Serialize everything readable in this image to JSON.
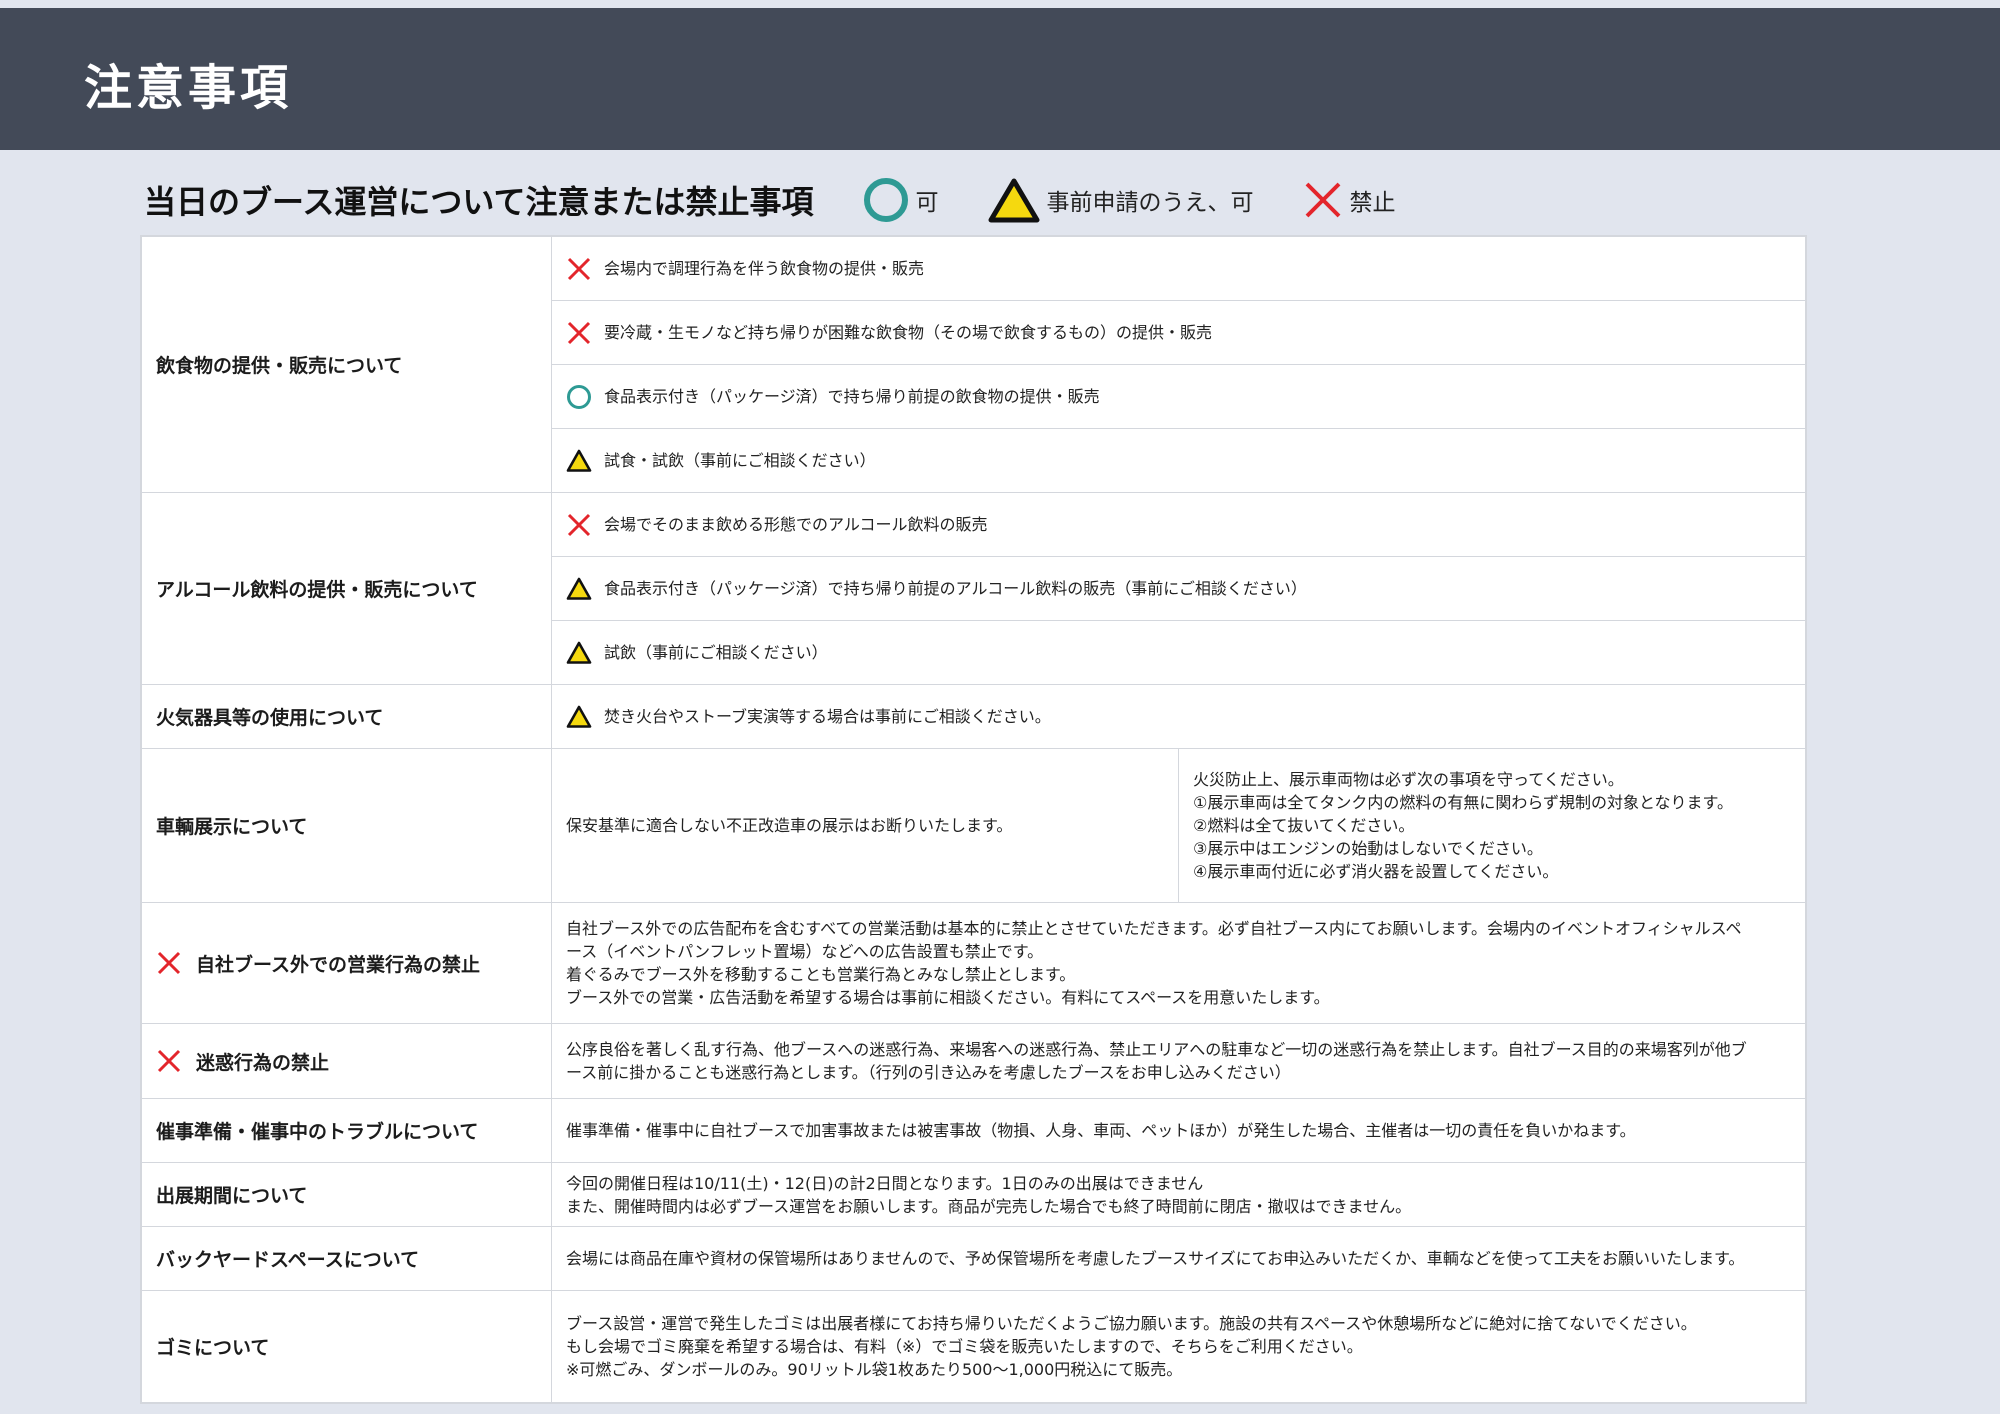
{
  "header": {
    "title": "注意事項"
  },
  "subtitle": "当日のブース運営について注意または禁止事項",
  "legend": [
    {
      "symbol": "circle",
      "label": "可"
    },
    {
      "symbol": "triangle",
      "label": "事前申請のうえ、可"
    },
    {
      "symbol": "cross",
      "label": "禁止"
    }
  ],
  "colors": {
    "header_bg": "#434a58",
    "page_bg": "#e1e5ee",
    "cross": "#e3252b",
    "circle": "#2e9a94",
    "triangle_fill": "#f5d90f"
  },
  "sections": {
    "food": {
      "label": "飲食物の提供・販売について",
      "items": [
        {
          "symbol": "cross",
          "text": "会場内で調理行為を伴う飲食物の提供・販売"
        },
        {
          "symbol": "cross",
          "text": "要冷蔵・生モノなど持ち帰りが困難な飲食物（その場で飲食するもの）の提供・販売"
        },
        {
          "symbol": "circle",
          "text": "食品表示付き（パッケージ済）で持ち帰り前提の飲食物の提供・販売"
        },
        {
          "symbol": "triangle",
          "text": "試食・試飲（事前にご相談ください）"
        }
      ]
    },
    "alcohol": {
      "label": "アルコール飲料の提供・販売について",
      "items": [
        {
          "symbol": "cross",
          "text": "会場でそのまま飲める形態でのアルコール飲料の販売"
        },
        {
          "symbol": "triangle",
          "text": "食品表示付き（パッケージ済）で持ち帰り前提のアルコール飲料の販売（事前にご相談ください）"
        },
        {
          "symbol": "triangle",
          "text": "試飲（事前にご相談ください）"
        }
      ]
    },
    "fire": {
      "label": "火気器具等の使用について",
      "text": "焚き火台やストーブ実演等する場合は事前にご相談ください。"
    },
    "vehicle": {
      "label": "車輌展示について",
      "left": "保安基準に適合しない不正改造車の展示はお断りいたします。",
      "right": [
        "火災防止上、展示車両物は必ず次の事項を守ってください。",
        "①展示車両は全てタンク内の燃料の有無に関わらず規制の対象となります。",
        "②燃料は全て抜いてください。",
        "③展示中はエンジンの始動はしないでください。",
        "④展示車両付近に必ず消火器を設置してください。"
      ]
    },
    "outside": {
      "label": "自社ブース外での営業行為の禁止",
      "lines": [
        "自社ブース外での広告配布を含むすべての営業活動は基本的に禁止とさせていただきます。必ず自社ブース内にてお願いします。会場内のイベントオフィシャルスペ",
        "ース（イベントパンフレット置場）などへの広告設置も禁止です。",
        "着ぐるみでブース外を移動することも営業行為とみなし禁止とします。",
        "ブース外での営業・広告活動を希望する場合は事前に相談ください。有料にてスペースを用意いたします。"
      ]
    },
    "nuisance": {
      "label": "迷惑行為の禁止",
      "lines": [
        "公序良俗を著しく乱す行為、他ブースへの迷惑行為、来場客への迷惑行為、禁止エリアへの駐車など一切の迷惑行為を禁止します。自社ブース目的の来場客列が他ブ",
        "ース前に掛かることも迷惑行為とします。（行列の引き込みを考慮したブースをお申し込みください）"
      ]
    },
    "trouble": {
      "label": "催事準備・催事中のトラブルについて",
      "text": "催事準備・催事中に自社ブースで加害事故または被害事故（物損、人身、車両、ペットほか）が発生した場合、主催者は一切の責任を負いかねます。"
    },
    "period": {
      "label": "出展期間について",
      "lines": [
        "今回の開催日程は10/11(土)・12(日)の計2日間となります。1日のみの出展はできません",
        "また、開催時間内は必ずブース運営をお願いします。商品が完売した場合でも終了時間前に閉店・撤収はできません。"
      ]
    },
    "backyard": {
      "label": "バックヤードスペースについて",
      "text": "会場には商品在庫や資材の保管場所はありませんので、予め保管場所を考慮したブースサイズにてお申込みいただくか、車輌などを使って工夫をお願いいたします。"
    },
    "trash": {
      "label": "ゴミについて",
      "lines": [
        "ブース設営・運営で発生したゴミは出展者様にてお持ち帰りいただくようご協力願います。施設の共有スペースや休憩場所などに絶対に捨てないでください。",
        "もし会場でゴミ廃棄を希望する場合は、有料（※）でゴミ袋を販売いたしますので、そちらをご利用ください。",
        "※可燃ごみ、ダンボールのみ。90リットル袋1枚あたり500〜1,000円税込にて販売。"
      ]
    }
  }
}
